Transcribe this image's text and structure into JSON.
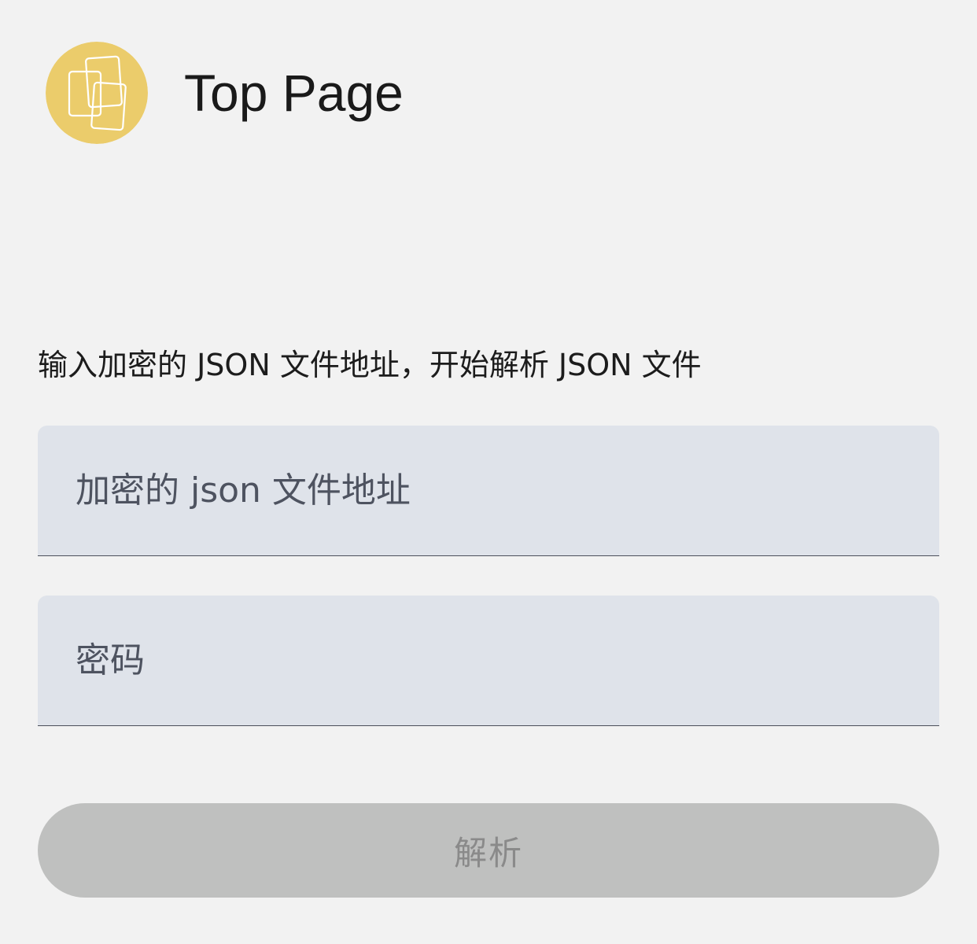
{
  "header": {
    "title": "Top Page",
    "logo_icon": "stacked-cards-icon",
    "logo_color": "#ebcc6b"
  },
  "form": {
    "instruction": "输入加密的 JSON 文件地址，开始解析 JSON 文件",
    "url_field": {
      "placeholder": "加密的 json 文件地址",
      "value": ""
    },
    "password_field": {
      "placeholder": "密码",
      "value": ""
    },
    "submit": {
      "label": "解析",
      "enabled": false
    }
  },
  "colors": {
    "background": "#f2f2f2",
    "field_fill": "#dfe3ea",
    "field_underline": "#4b4f5a",
    "button_disabled_fill": "#bfc0bf",
    "button_disabled_text": "#8a8a8a"
  }
}
